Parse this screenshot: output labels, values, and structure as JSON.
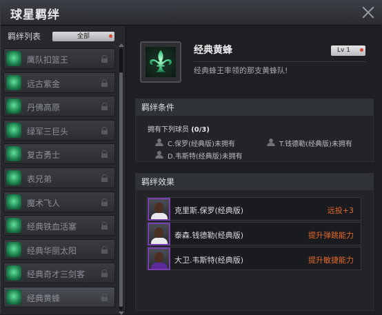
{
  "window": {
    "title": "球星羁绊"
  },
  "sidebar": {
    "list_title": "羁绊列表",
    "filter_label": "全部",
    "items": [
      {
        "label": "鹰队扣篮王",
        "icon": "hawks-dunk-icon"
      },
      {
        "label": "远古紫金",
        "icon": "lakers-ancient-icon"
      },
      {
        "label": "丹佛高原",
        "icon": "denver-icon"
      },
      {
        "label": "绿军三巨头",
        "icon": "celtics-big3-icon"
      },
      {
        "label": "复古勇士",
        "icon": "retro-warriors-icon"
      },
      {
        "label": "表兄弟",
        "icon": "cousins-icon"
      },
      {
        "label": "魔术飞人",
        "icon": "magic-icon"
      },
      {
        "label": "经典铁血活塞",
        "icon": "pistons-icon"
      },
      {
        "label": "经典华丽太阳",
        "icon": "suns-icon"
      },
      {
        "label": "经典奇才三剑客",
        "icon": "wizards-icon"
      },
      {
        "label": "经典黄蜂",
        "icon": "hornets-fleur-icon"
      }
    ]
  },
  "detail": {
    "name": "经典黄蜂",
    "level": "Lv 1",
    "description": "经典蜂王率领的那支黄蜂队!",
    "conditions": {
      "header": "羁绊条件",
      "requirement": "拥有下列球员",
      "progress": "(0/3)",
      "players": [
        "C.保罗(经典版)未拥有",
        "T.钱德勒(经典版)未拥有",
        "D.韦斯特(经典版)未拥有"
      ]
    },
    "effects": {
      "header": "羁绊效果",
      "rows": [
        {
          "player": "克里斯.保罗(经典版)",
          "bonus": "远投+3"
        },
        {
          "player": "泰森.钱德勒(经典版)",
          "bonus": "提升弹跳能力"
        },
        {
          "player": "大卫.韦斯特(经典版)",
          "bonus": "提升敏捷能力"
        }
      ]
    }
  },
  "colors": {
    "accent_orange": "#e46a2c",
    "emblem_green": "#5fe09a",
    "avatar_border": "#7a3fb0"
  }
}
